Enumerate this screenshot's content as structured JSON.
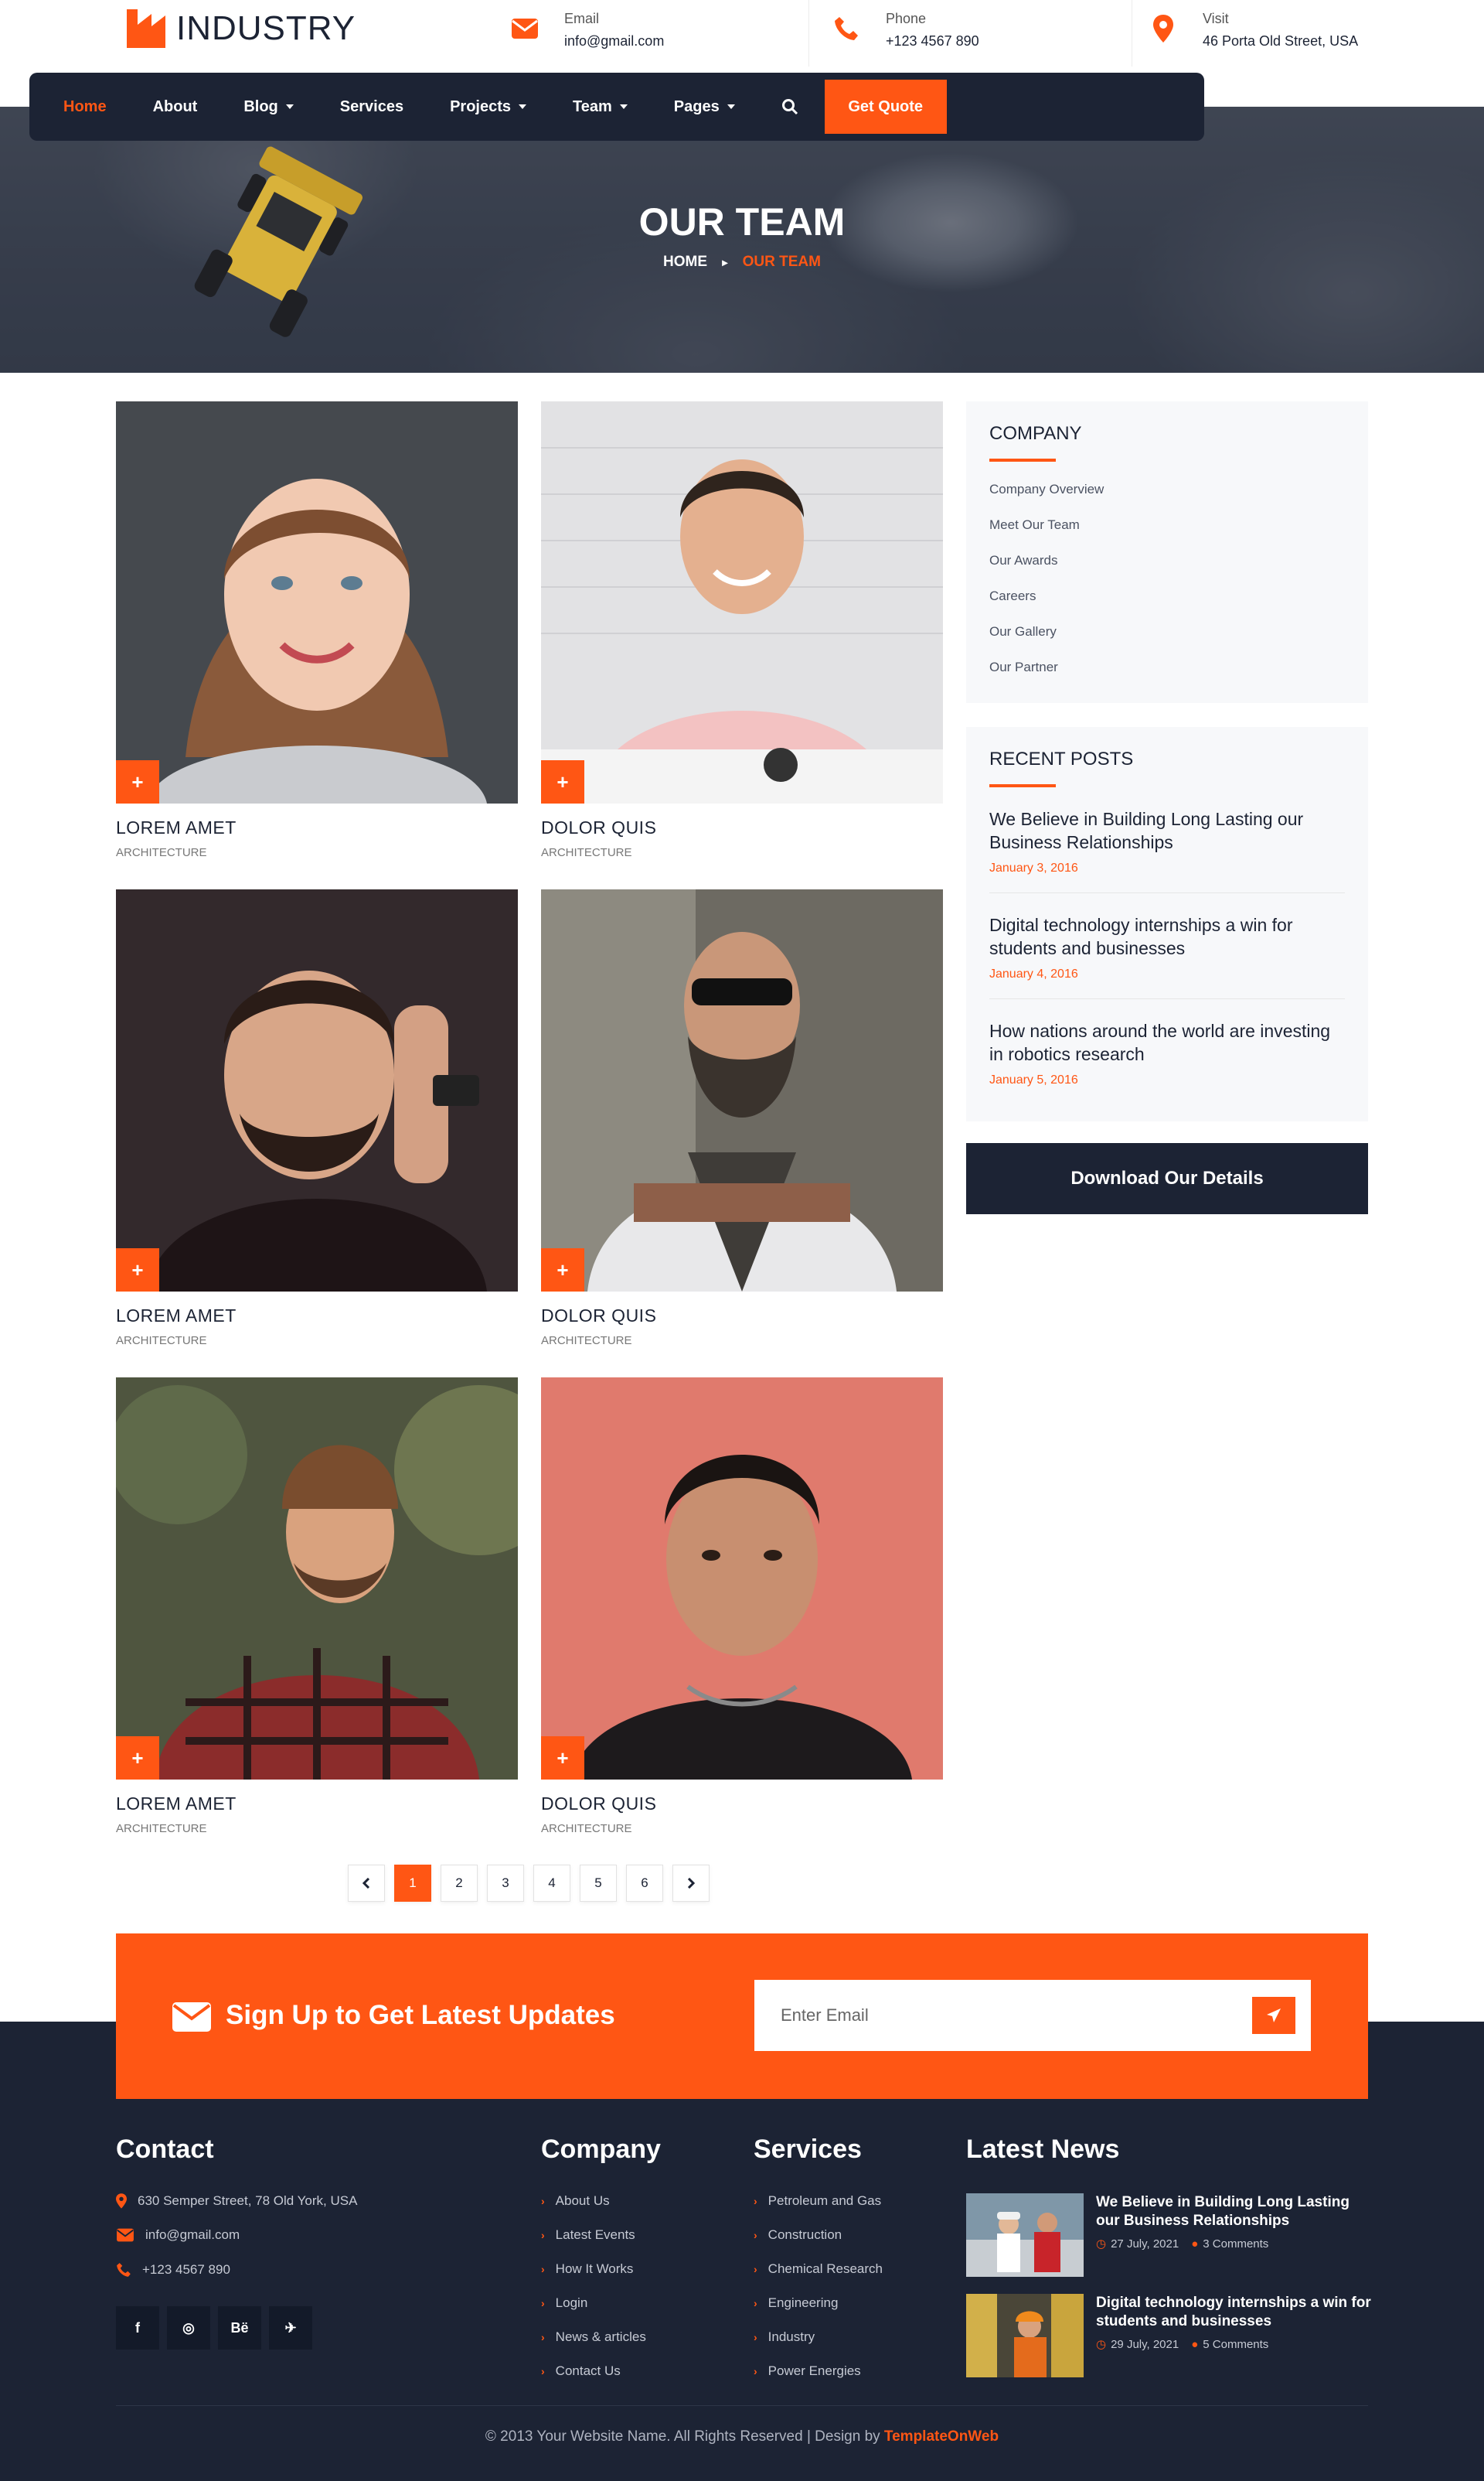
{
  "brand": {
    "name": "INDUSTRY"
  },
  "contact_bar": [
    {
      "label": "Email",
      "value": "info@gmail.com",
      "icon": "envelope-icon"
    },
    {
      "label": "Phone",
      "value": "+123 4567 890",
      "icon": "phone-icon"
    },
    {
      "label": "Visit",
      "value": "46 Porta Old Street, USA",
      "icon": "map-pin-icon"
    }
  ],
  "nav": {
    "items": [
      {
        "label": "Home",
        "active": true,
        "dropdown": false
      },
      {
        "label": "About",
        "dropdown": false
      },
      {
        "label": "Blog",
        "dropdown": true
      },
      {
        "label": "Services",
        "dropdown": false
      },
      {
        "label": "Projects",
        "dropdown": true
      },
      {
        "label": "Team",
        "dropdown": true
      },
      {
        "label": "Pages",
        "dropdown": true
      }
    ],
    "cta": "Get Quote"
  },
  "hero": {
    "title": "OUR TEAM",
    "breadcrumb_home": "HOME",
    "breadcrumb_current": "OUR TEAM"
  },
  "team": [
    {
      "name": "LOREM AMET",
      "role": "ARCHITECTURE"
    },
    {
      "name": "DOLOR QUIS",
      "role": "ARCHITECTURE"
    },
    {
      "name": "LOREM AMET",
      "role": "ARCHITECTURE"
    },
    {
      "name": "DOLOR QUIS",
      "role": "ARCHITECTURE"
    },
    {
      "name": "LOREM AMET",
      "role": "ARCHITECTURE"
    },
    {
      "name": "DOLOR QUIS",
      "role": "ARCHITECTURE"
    }
  ],
  "pagination": {
    "pages": [
      "1",
      "2",
      "3",
      "4",
      "5",
      "6"
    ],
    "current": "1"
  },
  "sidebar": {
    "company_title": "COMPANY",
    "company_links": [
      "Company Overview",
      "Meet Our Team",
      "Our Awards",
      "Careers",
      "Our Gallery",
      "Our Partner"
    ],
    "recent_title": "RECENT POSTS",
    "recent_posts": [
      {
        "title": "We Believe in Building Long Lasting our Business Relationships",
        "date": "January 3, 2016"
      },
      {
        "title": "Digital technology internships a win for students and businesses",
        "date": "January 4, 2016"
      },
      {
        "title": "How nations around the world are investing in robotics research",
        "date": "January 5, 2016"
      }
    ],
    "download": "Download Our Details"
  },
  "signup": {
    "text": "Sign Up to Get Latest Updates",
    "placeholder": "Enter Email"
  },
  "footer": {
    "contact_title": "Contact",
    "address": "630 Semper Street, 78 Old York, USA",
    "email": "info@gmail.com",
    "phone": "+123 4567 890",
    "social": [
      "f",
      "◎",
      "Bë",
      "✈"
    ],
    "company_title": "Company",
    "company_links": [
      "About Us",
      "Latest Events",
      "How It Works",
      "Login",
      "News & articles",
      "Contact Us"
    ],
    "services_title": "Services",
    "services_links": [
      "Petroleum and Gas",
      "Construction",
      "Chemical Research",
      "Engineering",
      "Industry",
      "Power Energies"
    ],
    "news_title": "Latest News",
    "news": [
      {
        "title": "We Believe in Building Long Lasting our Business Relationships",
        "date": "27 July, 2021",
        "comments": "3 Comments"
      },
      {
        "title": "Digital technology internships a win for students and businesses",
        "date": "29 July, 2021",
        "comments": "5 Comments"
      }
    ],
    "copyright_text": "© 2013 Your Website Name. All Rights Reserved | Design by ",
    "copyright_brand": "TemplateOnWeb"
  },
  "colors": {
    "accent": "#ff5614",
    "navy": "#1c2334"
  }
}
